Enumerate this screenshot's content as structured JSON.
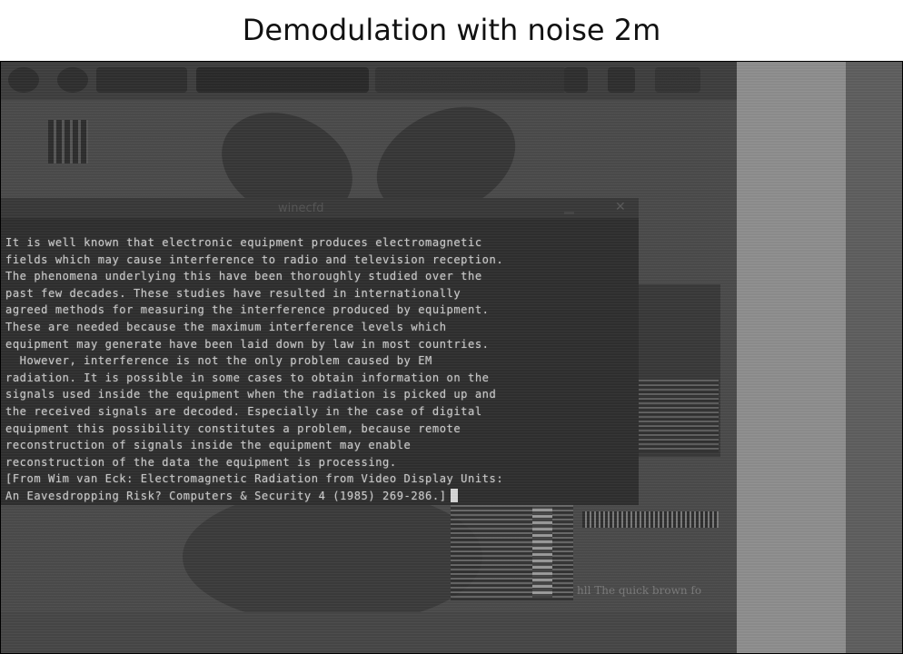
{
  "figure": {
    "title": "Demodulation with noise 2m"
  },
  "desktop": {
    "taskbar_items": [
      "",
      "",
      "",
      "",
      "",
      ""
    ],
    "window_title": "winecfd"
  },
  "terminal": {
    "lines": [
      "It is well known that electronic equipment produces electromagnetic",
      "fields which may cause interference to radio and television reception.",
      "The phenomena underlying this have been thoroughly studied over the",
      "past few decades. These studies have resulted in internationally",
      "agreed methods for measuring the interference produced by equipment.",
      "These are needed because the maximum interference levels which",
      "equipment may generate have been laid down by law in most countries.",
      "  However, interference is not the only problem caused by EM",
      "radiation. It is possible in some cases to obtain information on the",
      "signals used inside the equipment when the radiation is picked up and",
      "the received signals are decoded. Especially in the case of digital",
      "equipment this possibility constitutes a problem, because remote",
      "reconstruction of signals inside the equipment may enable",
      "reconstruction of the data the equipment is processing.",
      "[From Wim van Eck: Electromagnetic Radiation from Video Display Units:",
      "An Eavesdropping Risk? Computers & Security 4 (1985) 269-286.]"
    ]
  },
  "faint_caption": "hll The quick brown fo",
  "colors": {
    "background": "#4b4b4b",
    "terminal_text": "#c9c9c9",
    "light_band": "#8e8e8e"
  }
}
